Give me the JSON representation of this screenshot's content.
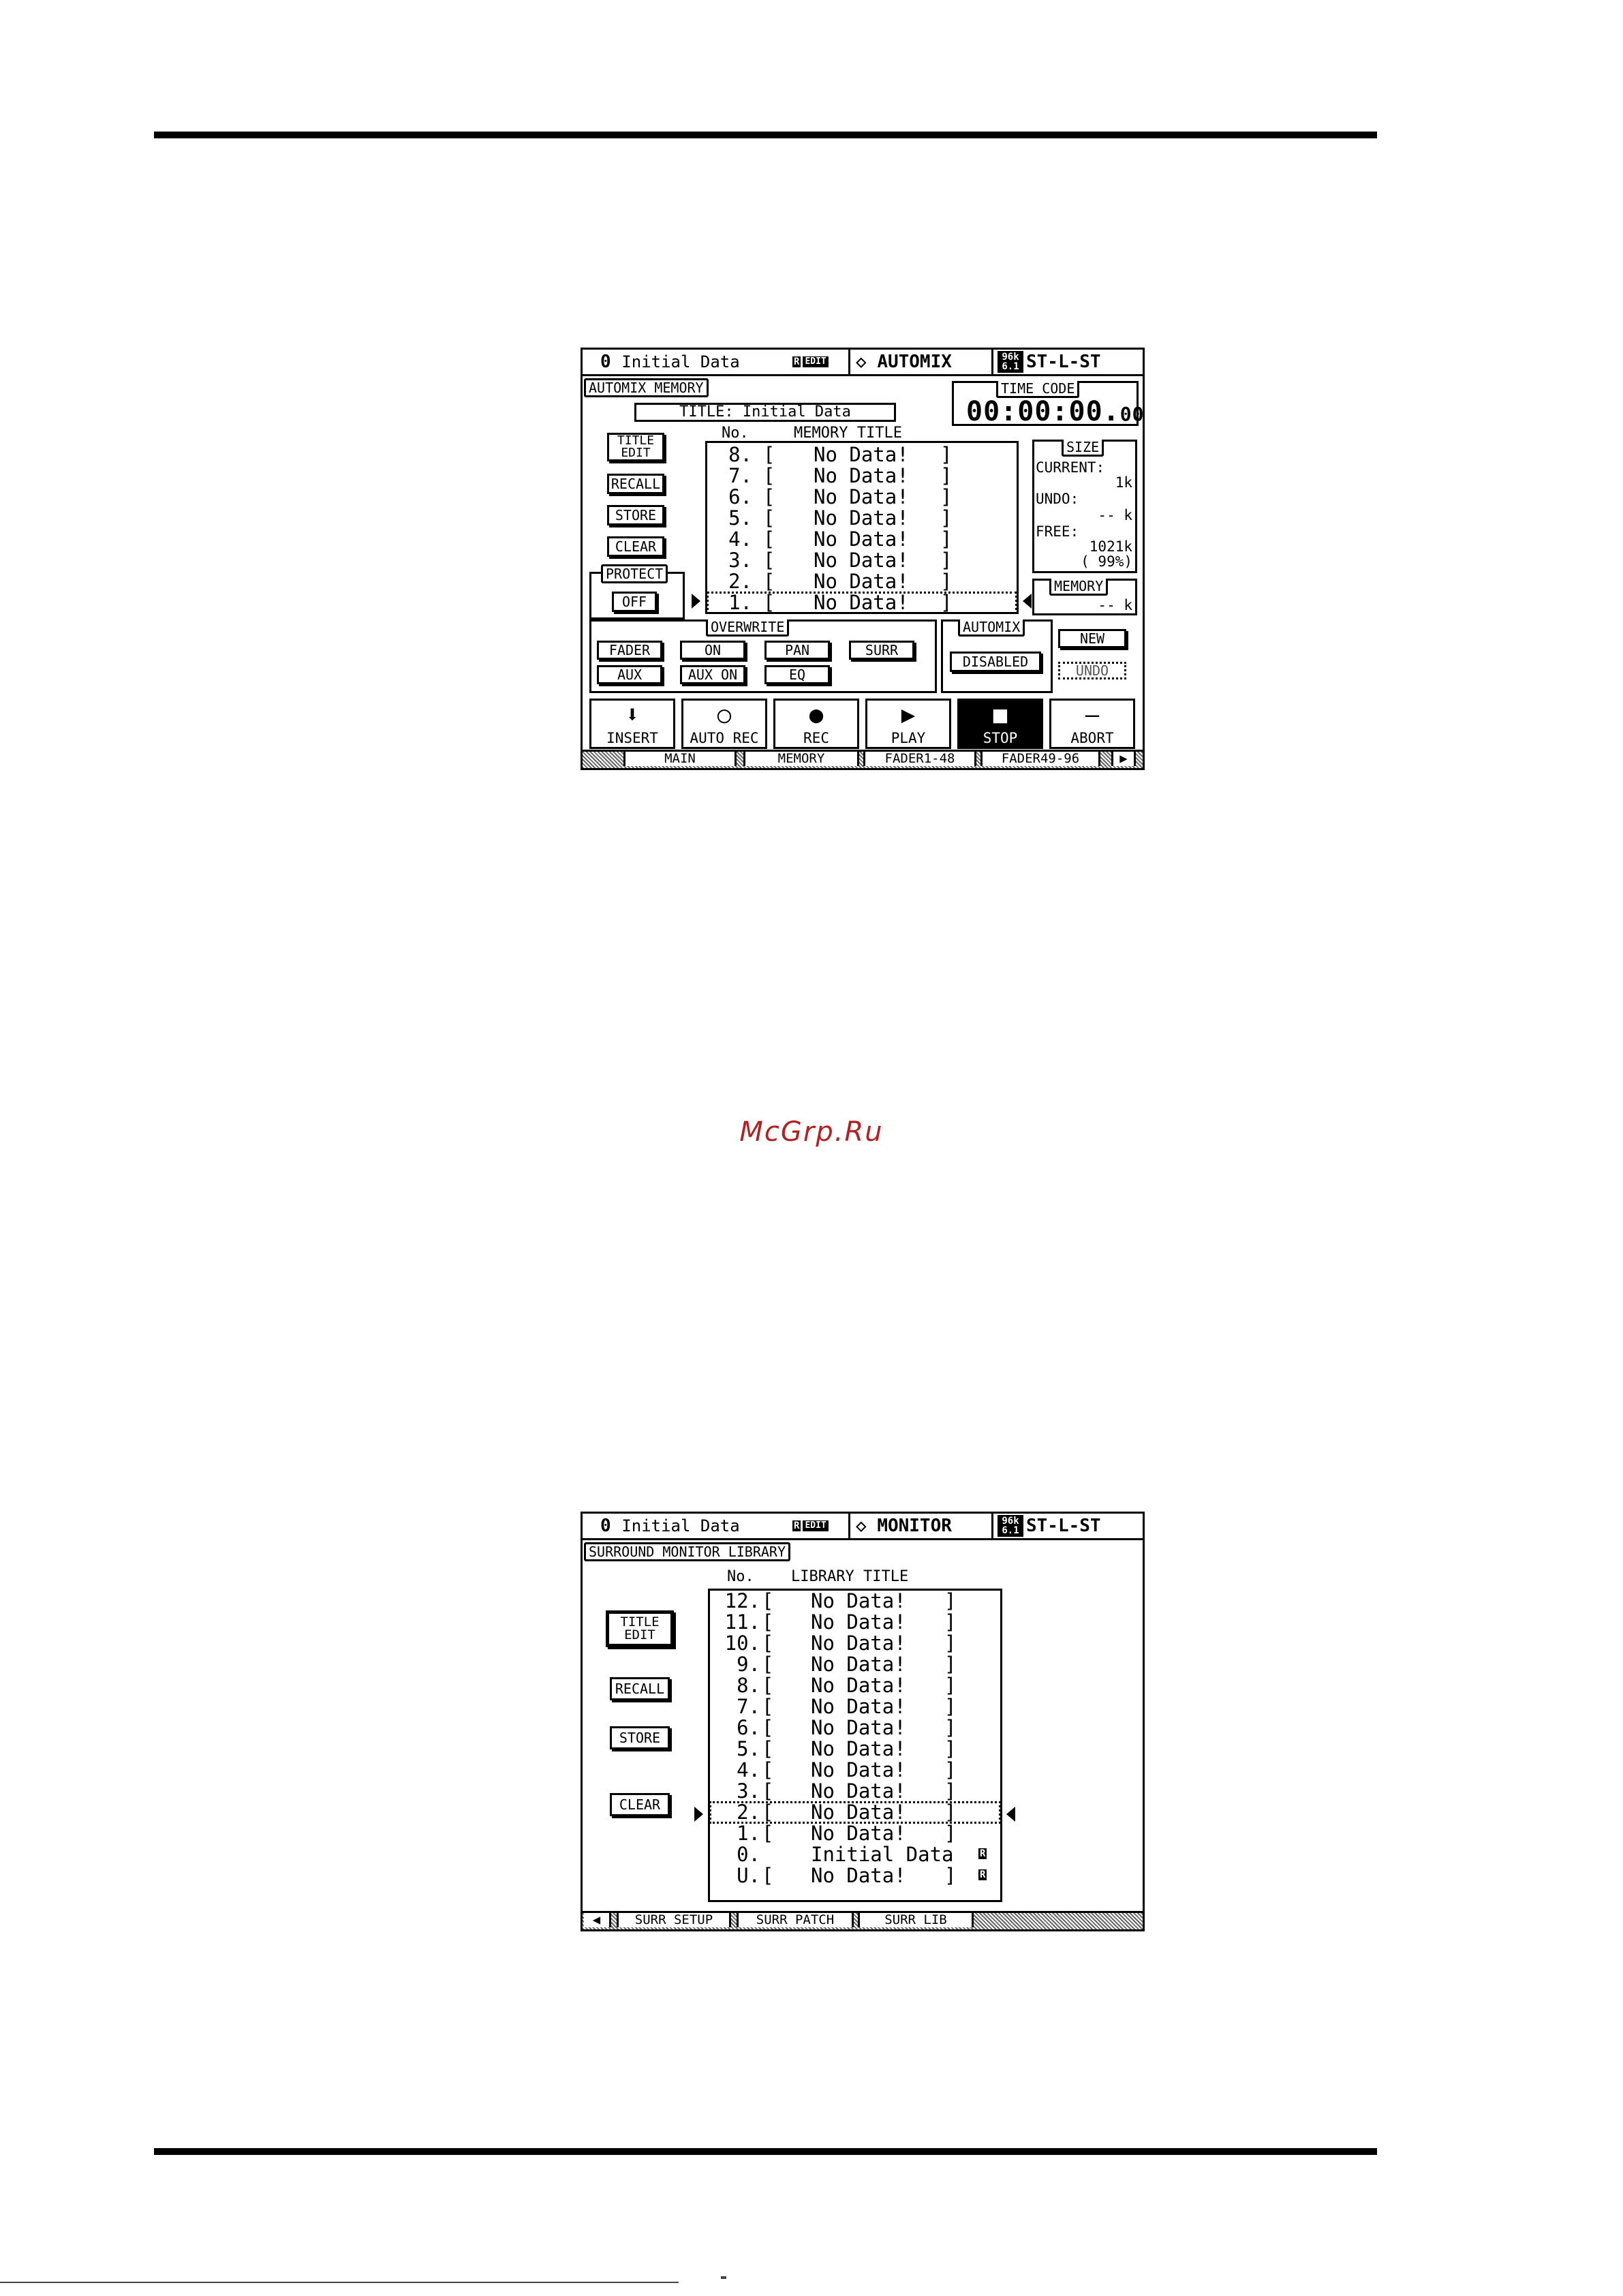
{
  "screen1": {
    "header": {
      "scene_number": "0",
      "scene_title": "Initial Data",
      "r_badge": "R",
      "edit_badge": "EDIT",
      "page_name": "AUTOMIX",
      "fs_top": "96k",
      "fs_bottom": "6.1",
      "layer": "ST-L-ST"
    },
    "section_label": "AUTOMIX MEMORY",
    "title_field": "TITLE: Initial Data",
    "time_code": {
      "label": "TIME CODE",
      "value_main": "00:00:00.",
      "value_frames": "00"
    },
    "buttons": {
      "title_edit_1": "TITLE",
      "title_edit_2": "EDIT",
      "recall": "RECALL",
      "store": "STORE",
      "clear": "CLEAR"
    },
    "protect": {
      "label": "PROTECT",
      "value": "OFF"
    },
    "list": {
      "header_no": "No.",
      "header_title": "MEMORY TITLE",
      "rows": [
        {
          "no": "8.",
          "open": "[",
          "title": "No Data!",
          "close": "]"
        },
        {
          "no": "7.",
          "open": "[",
          "title": "No Data!",
          "close": "]"
        },
        {
          "no": "6.",
          "open": "[",
          "title": "No Data!",
          "close": "]"
        },
        {
          "no": "5.",
          "open": "[",
          "title": "No Data!",
          "close": "]"
        },
        {
          "no": "4.",
          "open": "[",
          "title": "No Data!",
          "close": "]"
        },
        {
          "no": "3.",
          "open": "[",
          "title": "No Data!",
          "close": "]"
        },
        {
          "no": "2.",
          "open": "[",
          "title": "No Data!",
          "close": "]"
        },
        {
          "no": "1.",
          "open": "[",
          "title": "No Data!",
          "close": "]"
        }
      ],
      "selected_row": "1."
    },
    "size": {
      "label": "SIZE",
      "current_label": "CURRENT:",
      "current_value": "1k",
      "undo_label": "UNDO:",
      "undo_value": "-- k",
      "free_label": "FREE:",
      "free_value": "1021k",
      "free_percent": "( 99%)"
    },
    "memory": {
      "label": "MEMORY",
      "value": "-- k"
    },
    "overwrite": {
      "label": "OVERWRITE",
      "fader": "FADER",
      "on": "ON",
      "pan": "PAN",
      "surr": "SURR",
      "aux": "AUX",
      "aux_on": "AUX ON",
      "eq": "EQ"
    },
    "automix": {
      "label": "AUTOMIX",
      "value": "DISABLED"
    },
    "new_button": "NEW",
    "undo_button": "UNDO",
    "transport": [
      {
        "icon": "⬇",
        "label": "INSERT",
        "icon_name": "insert-arrow-icon"
      },
      {
        "icon": "○",
        "label": "AUTO REC",
        "icon_name": "auto-rec-circle-icon"
      },
      {
        "icon": "●",
        "label": "REC",
        "icon_name": "rec-dot-icon"
      },
      {
        "icon": "▶",
        "label": "PLAY",
        "icon_name": "play-icon"
      },
      {
        "icon": "■",
        "label": "STOP",
        "icon_name": "stop-icon"
      },
      {
        "icon": "—",
        "label": "ABORT",
        "icon_name": "abort-dash-icon"
      }
    ],
    "tabs": [
      "MAIN",
      "MEMORY",
      "FADER1-48",
      "FADER49-96"
    ],
    "active_tab": "MEMORY"
  },
  "screen2": {
    "header": {
      "scene_number": "0",
      "scene_title": "Initial Data",
      "r_badge": "R",
      "edit_badge": "EDIT",
      "page_name": "MONITOR",
      "fs_top": "96k",
      "fs_bottom": "6.1",
      "layer": "ST-L-ST"
    },
    "section_label": "SURROUND MONITOR LIBRARY",
    "buttons": {
      "title_edit_1": "TITLE",
      "title_edit_2": "EDIT",
      "recall": "RECALL",
      "store": "STORE",
      "clear": "CLEAR"
    },
    "list": {
      "header_no": "No.",
      "header_title": "LIBRARY TITLE",
      "rows": [
        {
          "no": "12.",
          "open": "[",
          "title": "No Data!",
          "close": "]",
          "r": ""
        },
        {
          "no": "11.",
          "open": "[",
          "title": "No Data!",
          "close": "]",
          "r": ""
        },
        {
          "no": "10.",
          "open": "[",
          "title": "No Data!",
          "close": "]",
          "r": ""
        },
        {
          "no": "9.",
          "open": "[",
          "title": "No Data!",
          "close": "]",
          "r": ""
        },
        {
          "no": "8.",
          "open": "[",
          "title": "No Data!",
          "close": "]",
          "r": ""
        },
        {
          "no": "7.",
          "open": "[",
          "title": "No Data!",
          "close": "]",
          "r": ""
        },
        {
          "no": "6.",
          "open": "[",
          "title": "No Data!",
          "close": "]",
          "r": ""
        },
        {
          "no": "5.",
          "open": "[",
          "title": "No Data!",
          "close": "]",
          "r": ""
        },
        {
          "no": "4.",
          "open": "[",
          "title": "No Data!",
          "close": "]",
          "r": ""
        },
        {
          "no": "3.",
          "open": "[",
          "title": "No Data!",
          "close": "]",
          "r": ""
        },
        {
          "no": "2.",
          "open": "[",
          "title": "No Data!",
          "close": "]",
          "r": ""
        },
        {
          "no": "1.",
          "open": "[",
          "title": "No Data!",
          "close": "]",
          "r": ""
        },
        {
          "no": "0.",
          "open": "",
          "title": "Initial Data",
          "close": "",
          "r": "R"
        },
        {
          "no": "U.",
          "open": "[",
          "title": "No Data!",
          "close": "]",
          "r": "R"
        }
      ],
      "selected_row": "2."
    },
    "tabs": [
      "SURR SETUP",
      "SURR PATCH",
      "SURR LIB"
    ],
    "active_tab": "SURR LIB"
  },
  "watermark": "McGrp.Ru"
}
